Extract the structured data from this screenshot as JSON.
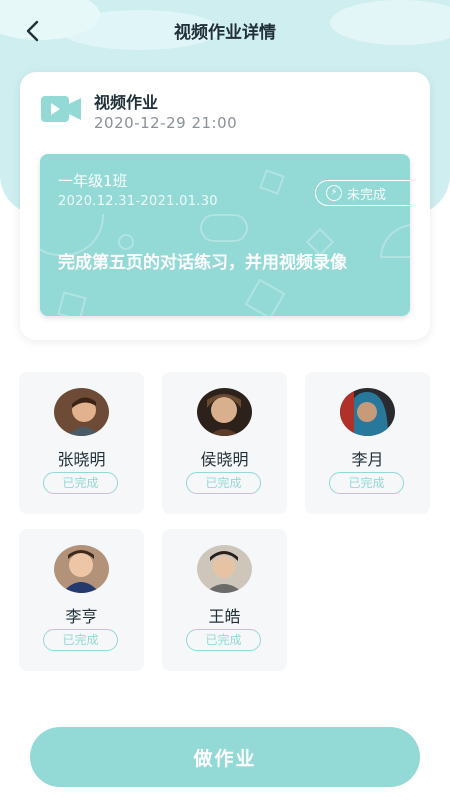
{
  "nav": {
    "title": "视频作业详情"
  },
  "homework": {
    "type": "视频作业",
    "published_at": "2020-12-29 21:00",
    "class_name": "一年级1班",
    "date_range": "2020.12.31-2021.01.30",
    "status": "未完成",
    "description": "完成第五页的对话练习，并用视频录像"
  },
  "students": [
    {
      "name": "张晓明",
      "status": "已完成"
    },
    {
      "name": "侯晓明",
      "status": "已完成"
    },
    {
      "name": "李月",
      "status": "已完成"
    },
    {
      "name": "李亨",
      "status": "已完成"
    },
    {
      "name": "王皓",
      "status": "已完成"
    }
  ],
  "action": {
    "label": "做作业"
  },
  "colors": {
    "accent": "#93d9d6",
    "header_bg": "#cfeef0"
  }
}
